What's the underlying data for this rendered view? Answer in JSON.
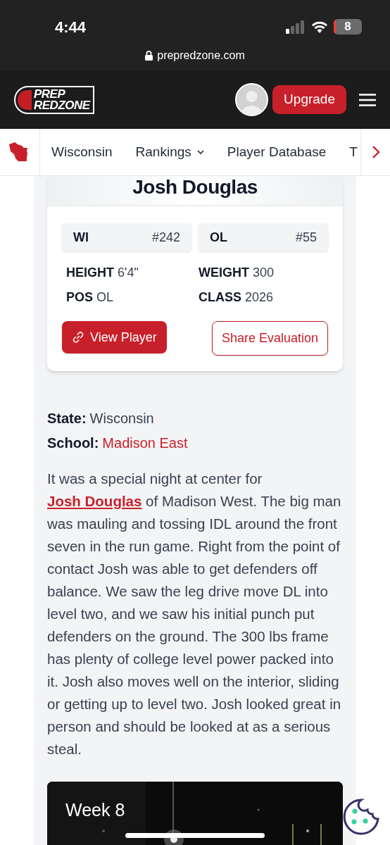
{
  "status_bar": {
    "time": "4:44",
    "battery": "8"
  },
  "address_bar": {
    "url": "prepredzone.com"
  },
  "header": {
    "logo": [
      "PREP",
      "REDZONE"
    ],
    "button": "Upgrade"
  },
  "nav": {
    "items": [
      {
        "label": "Wisconsin",
        "dropdown": false
      },
      {
        "label": "Rankings",
        "dropdown": true
      },
      {
        "label": "Player Database",
        "dropdown": false
      },
      {
        "label": "T",
        "dropdown": false
      }
    ]
  },
  "player_card": {
    "name": "Josh Douglas",
    "ranks": [
      {
        "label": "WI",
        "value": "#242"
      },
      {
        "label": "OL",
        "value": "#55"
      }
    ],
    "stats": [
      {
        "label": "HEIGHT",
        "value": "6'4\""
      },
      {
        "label": "WEIGHT",
        "value": "300"
      },
      {
        "label": "POS",
        "value": "OL"
      },
      {
        "label": "CLASS",
        "value": "2026"
      }
    ],
    "buttons": [
      {
        "label": "View Player",
        "kind": "primary"
      },
      {
        "label": "Share Evaluation",
        "kind": "outline"
      }
    ]
  },
  "info": [
    {
      "label": "State:",
      "value": "Wisconsin",
      "link": false
    },
    {
      "label": "School:",
      "value": "Madison East",
      "link": true
    }
  ],
  "article": {
    "before": "It was a special night at center for",
    "link": "Josh Douglas",
    "after": " of Madison West. The big man was mauling and tossing IDL around the front seven in the run game. Right from the point of contact Josh was able to get defenders off balance. We saw the leg drive move DL into level two, and we saw his initial punch put defenders on the ground. The 300 lbs frame has plenty of college level power packed into it. Josh also moves well on the interior, sliding or getting up to level two. Josh looked great in person and should be looked at as a serious steal."
  },
  "video": {
    "kind": "picture",
    "title": "Week 8"
  }
}
